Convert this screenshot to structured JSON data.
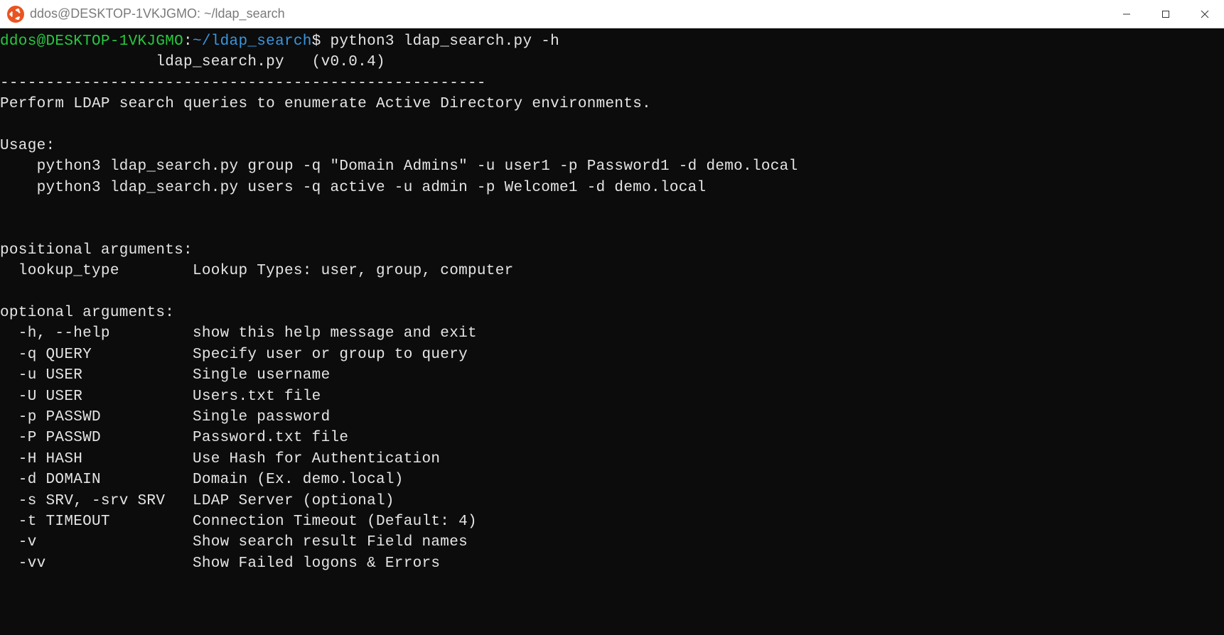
{
  "window": {
    "title": "ddos@DESKTOP-1VKJGMO: ~/ldap_search"
  },
  "prompt": {
    "user_host": "ddos@DESKTOP-1VKJGMO",
    "colon": ":",
    "path": "~/ldap_search",
    "dollar": "$ "
  },
  "command": "python3 ldap_search.py -h",
  "output": {
    "banner": "                 ldap_search.py   (v0.0.4)",
    "divider": "-----------------------------------------------------",
    "description": "Perform LDAP search queries to enumerate Active Directory environments.",
    "usage_header": "Usage:",
    "usage1": "    python3 ldap_search.py group -q \"Domain Admins\" -u user1 -p Password1 -d demo.local",
    "usage2": "    python3 ldap_search.py users -q active -u admin -p Welcome1 -d demo.local",
    "positional_header": "positional arguments:",
    "positional1": "  lookup_type        Lookup Types: user, group, computer",
    "optional_header": "optional arguments:",
    "opt_h": "  -h, --help         show this help message and exit",
    "opt_q": "  -q QUERY           Specify user or group to query",
    "opt_u": "  -u USER            Single username",
    "opt_U": "  -U USER            Users.txt file",
    "opt_p": "  -p PASSWD          Single password",
    "opt_P": "  -P PASSWD          Password.txt file",
    "opt_H": "  -H HASH            Use Hash for Authentication",
    "opt_d": "  -d DOMAIN          Domain (Ex. demo.local)",
    "opt_s": "  -s SRV, -srv SRV   LDAP Server (optional)",
    "opt_t": "  -t TIMEOUT         Connection Timeout (Default: 4)",
    "opt_v": "  -v                 Show search result Field names",
    "opt_vv": "  -vv                Show Failed logons & Errors"
  }
}
